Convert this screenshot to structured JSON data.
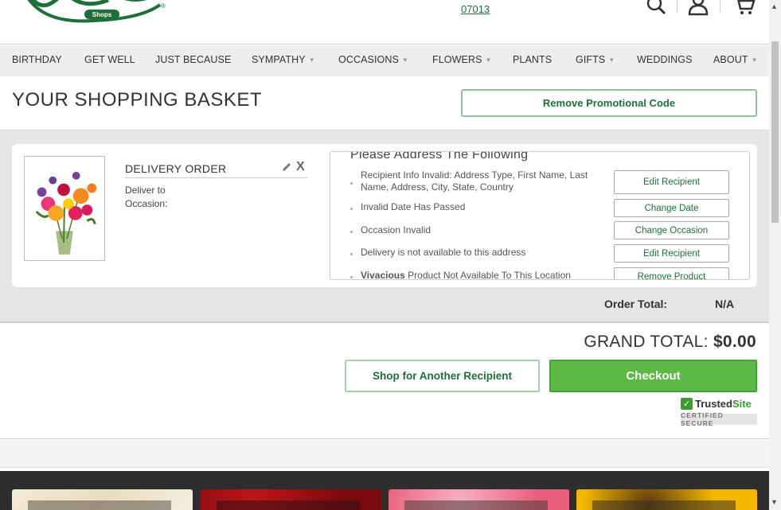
{
  "header": {
    "zip_cut": "",
    "zip": "07013"
  },
  "nav": [
    {
      "label": "BIRTHDAY",
      "dropdown": false
    },
    {
      "label": "GET WELL",
      "dropdown": false
    },
    {
      "label": "JUST BECAUSE",
      "dropdown": false
    },
    {
      "label": "SYMPATHY",
      "dropdown": true
    },
    {
      "label": "OCCASIONS",
      "dropdown": true
    },
    {
      "label": "FLOWERS",
      "dropdown": true
    },
    {
      "label": "PLANTS",
      "dropdown": false
    },
    {
      "label": "GIFTS",
      "dropdown": true
    },
    {
      "label": "WEDDINGS",
      "dropdown": false
    },
    {
      "label": "ABOUT",
      "dropdown": true
    }
  ],
  "page": {
    "title": "YOUR SHOPPING BASKET",
    "promo_button": "Remove Promotional Code"
  },
  "order": {
    "label": "DELIVERY ORDER",
    "deliver_to": "Deliver to",
    "occasion": "Occasion:",
    "close_glyph": "X",
    "issues_title": "Please Address The Following",
    "issues": [
      {
        "text": "Recipient Info Invalid: Address Type, First Name, Last Name, Address, City, State, Country",
        "action": "Edit Recipient"
      },
      {
        "text": "Invalid Date Has Passed",
        "action": "Change Date"
      },
      {
        "text": "Occasion Invalid",
        "action": "Change Occasion"
      },
      {
        "text": "Delivery is not available to this address",
        "action": "Edit Recipient"
      },
      {
        "product": "Vivacious",
        "text": " Product Not Available To This Location",
        "action": "Remove Product"
      }
    ],
    "total_label": "Order Total:",
    "total_value": "N/A"
  },
  "totals": {
    "grand_label": "GRAND TOTAL:",
    "grand_value": "$0.00",
    "shop_button": "Shop for Another Recipient",
    "checkout_button": "Checkout",
    "trusted_name": "Trusted",
    "trusted_site": "Site",
    "trusted_sub": "CERTIFIED SECURE"
  },
  "colors": {
    "brand_green": "#1f6f3a",
    "checkout_green": "#5cb948"
  }
}
